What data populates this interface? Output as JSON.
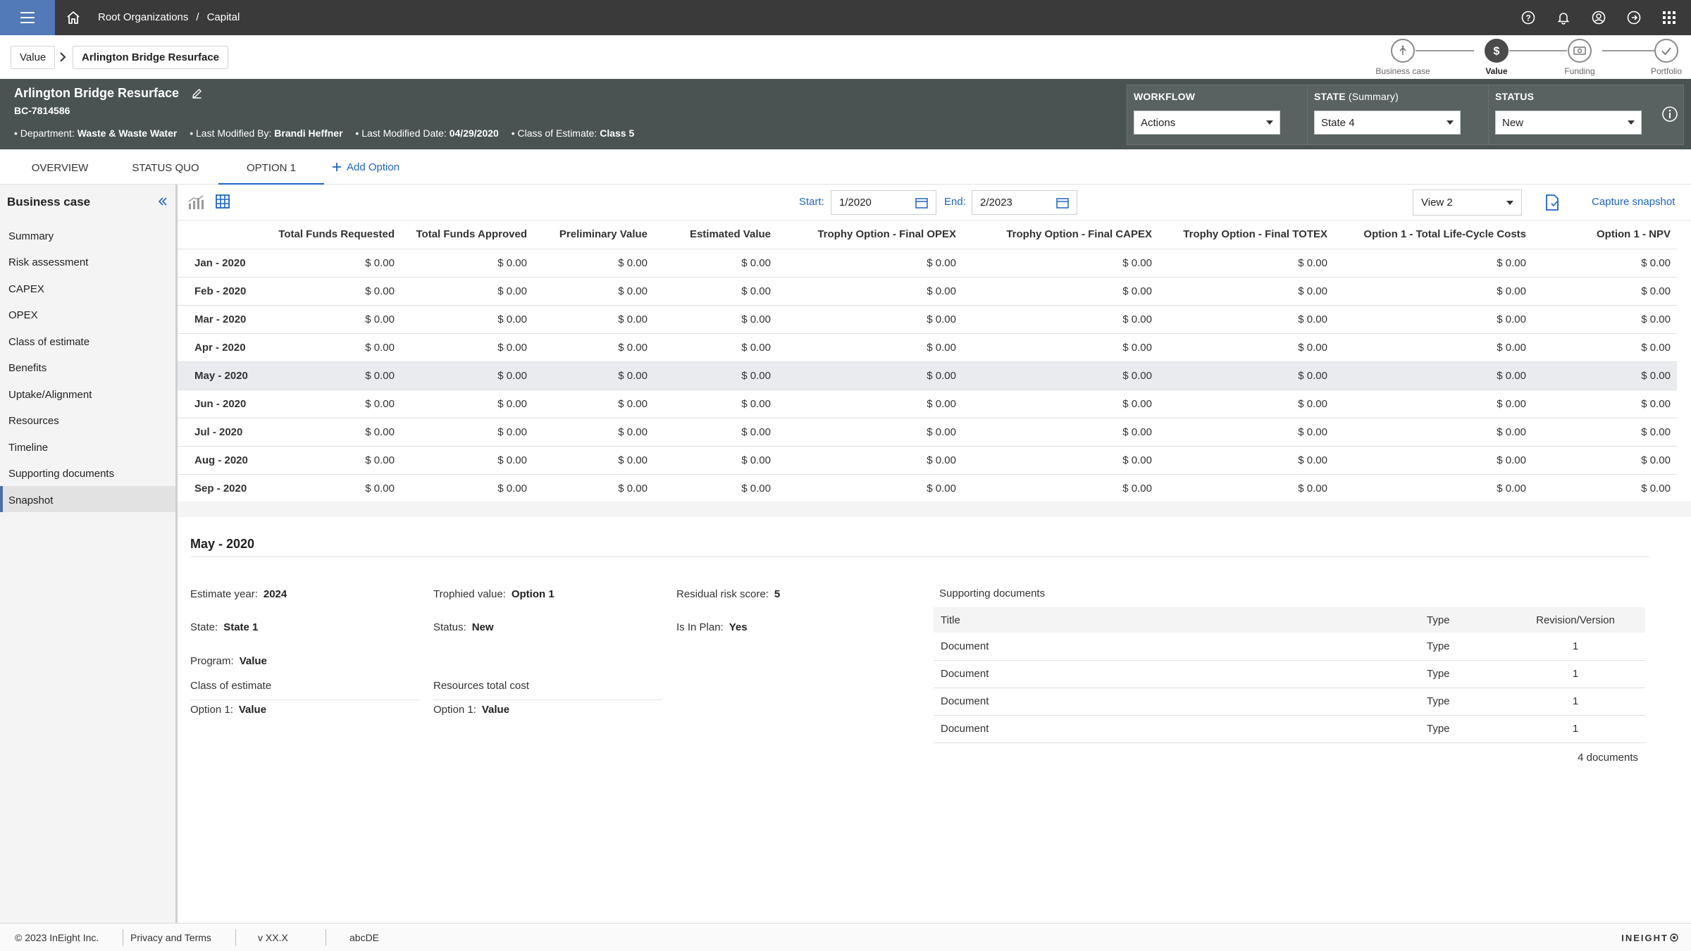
{
  "topbar": {
    "crumbs": [
      "Root Organizations",
      "Capital"
    ],
    "crumb_separator": "/"
  },
  "breadcrumb": {
    "value_label": "Value",
    "current": "Arlington Bridge Resurface"
  },
  "stepper": {
    "steps": [
      {
        "label": "Business case",
        "icon": "person-up-icon",
        "active": false
      },
      {
        "label": "Value",
        "icon": "dollar-icon",
        "active": true
      },
      {
        "label": "Funding",
        "icon": "money-icon",
        "active": false
      },
      {
        "label": "Portfolio",
        "icon": "check-icon",
        "active": false
      }
    ]
  },
  "header": {
    "title": "Arlington Bridge Resurface",
    "code": "BC-7814586",
    "meta": [
      {
        "label": "Department:",
        "value": "Waste & Waste Water"
      },
      {
        "label": "Last Modified By:",
        "value": "Brandi Heffner"
      },
      {
        "label": "Last Modified Date:",
        "value": "04/29/2020"
      },
      {
        "label": "Class of Estimate:",
        "value": "Class 5"
      }
    ],
    "workflow": {
      "title": "WORKFLOW",
      "value": "Actions"
    },
    "state": {
      "title": "STATE",
      "sub": "(Summary)",
      "value": "State 4"
    },
    "status": {
      "title": "STATUS",
      "value": "New"
    },
    "colors": {
      "bg": "#4b5252",
      "box": "#5a6161"
    }
  },
  "tabs": {
    "overview": "OVERVIEW",
    "status_quo": "STATUS QUO",
    "option1": "OPTION 1",
    "add": "Add Option"
  },
  "sidebar": {
    "title": "Business case",
    "items": [
      "Summary",
      "Risk assessment",
      "CAPEX",
      "OPEX",
      "Class of estimate",
      "Benefits",
      "Uptake/Alignment",
      "Resources",
      "Timeline",
      "Supporting documents",
      "Snapshot"
    ],
    "active": "Snapshot"
  },
  "toolbar": {
    "start_label": "Start:",
    "start_value": "1/2020",
    "end_label": "End:",
    "end_value": "2/2023",
    "view": "View 2",
    "capture": "Capture snapshot"
  },
  "grid": {
    "columns": [
      "Total Funds Requested",
      "Total Funds Approved",
      "Preliminary Value",
      "Estimated Value",
      "Trophy Option - Final OPEX",
      "Trophy Option - Final CAPEX",
      "Trophy Option - Final TOTEX",
      "Option 1 - Total Life-Cycle Costs",
      "Option 1 - NPV"
    ],
    "rows": [
      {
        "month": "Jan - 2020",
        "values": [
          "$ 0.00",
          "$ 0.00",
          "$ 0.00",
          "$ 0.00",
          "$ 0.00",
          "$ 0.00",
          "$ 0.00",
          "$ 0.00",
          "$ 0.00"
        ]
      },
      {
        "month": "Feb - 2020",
        "values": [
          "$ 0.00",
          "$ 0.00",
          "$ 0.00",
          "$ 0.00",
          "$ 0.00",
          "$ 0.00",
          "$ 0.00",
          "$ 0.00",
          "$ 0.00"
        ]
      },
      {
        "month": "Mar - 2020",
        "values": [
          "$ 0.00",
          "$ 0.00",
          "$ 0.00",
          "$ 0.00",
          "$ 0.00",
          "$ 0.00",
          "$ 0.00",
          "$ 0.00",
          "$ 0.00"
        ]
      },
      {
        "month": "Apr - 2020",
        "values": [
          "$ 0.00",
          "$ 0.00",
          "$ 0.00",
          "$ 0.00",
          "$ 0.00",
          "$ 0.00",
          "$ 0.00",
          "$ 0.00",
          "$ 0.00"
        ]
      },
      {
        "month": "May - 2020",
        "values": [
          "$ 0.00",
          "$ 0.00",
          "$ 0.00",
          "$ 0.00",
          "$ 0.00",
          "$ 0.00",
          "$ 0.00",
          "$ 0.00",
          "$ 0.00"
        ],
        "selected": true
      },
      {
        "month": "Jun - 2020",
        "values": [
          "$ 0.00",
          "$ 0.00",
          "$ 0.00",
          "$ 0.00",
          "$ 0.00",
          "$ 0.00",
          "$ 0.00",
          "$ 0.00",
          "$ 0.00"
        ]
      },
      {
        "month": "Jul - 2020",
        "values": [
          "$ 0.00",
          "$ 0.00",
          "$ 0.00",
          "$ 0.00",
          "$ 0.00",
          "$ 0.00",
          "$ 0.00",
          "$ 0.00",
          "$ 0.00"
        ]
      },
      {
        "month": "Aug - 2020",
        "values": [
          "$ 0.00",
          "$ 0.00",
          "$ 0.00",
          "$ 0.00",
          "$ 0.00",
          "$ 0.00",
          "$ 0.00",
          "$ 0.00",
          "$ 0.00"
        ]
      },
      {
        "month": "Sep - 2020",
        "values": [
          "$ 0.00",
          "$ 0.00",
          "$ 0.00",
          "$ 0.00",
          "$ 0.00",
          "$ 0.00",
          "$ 0.00",
          "$ 0.00",
          "$ 0.00"
        ]
      }
    ]
  },
  "detail": {
    "title": "May - 2020",
    "estimate_year": {
      "label": "Estimate year:",
      "value": "2024"
    },
    "trophied": {
      "label": "Trophied value:",
      "value": "Option 1"
    },
    "risk": {
      "label": "Residual risk score:",
      "value": "5"
    },
    "state": {
      "label": "State:",
      "value": "State 1"
    },
    "status": {
      "label": "Status:",
      "value": "New"
    },
    "in_plan": {
      "label": "Is In Plan:",
      "value": "Yes"
    },
    "program": {
      "label": "Program:",
      "value": "Value"
    },
    "class_of_estimate": {
      "title": "Class of estimate",
      "label": "Option 1:",
      "value": "Value"
    },
    "resources": {
      "title": "Resources total cost",
      "label": "Option 1:",
      "value": "Value"
    },
    "docs": {
      "title": "Supporting documents",
      "headers": [
        "Title",
        "Type",
        "Revision/Version"
      ],
      "rows": [
        [
          "Document",
          "Type",
          "1"
        ],
        [
          "Document",
          "Type",
          "1"
        ],
        [
          "Document",
          "Type",
          "1"
        ],
        [
          "Document",
          "Type",
          "1"
        ]
      ],
      "count": "4 documents"
    }
  },
  "footer": {
    "copyright": "© 2023 InEight Inc.",
    "privacy": "Privacy and Terms",
    "version": "v XX.X",
    "code": "abcDE",
    "logo": "INEIGHT"
  },
  "colors": {
    "accent": "#1e63c6",
    "hamburger": "#5279b8",
    "topbar": "#3a3a3a"
  }
}
